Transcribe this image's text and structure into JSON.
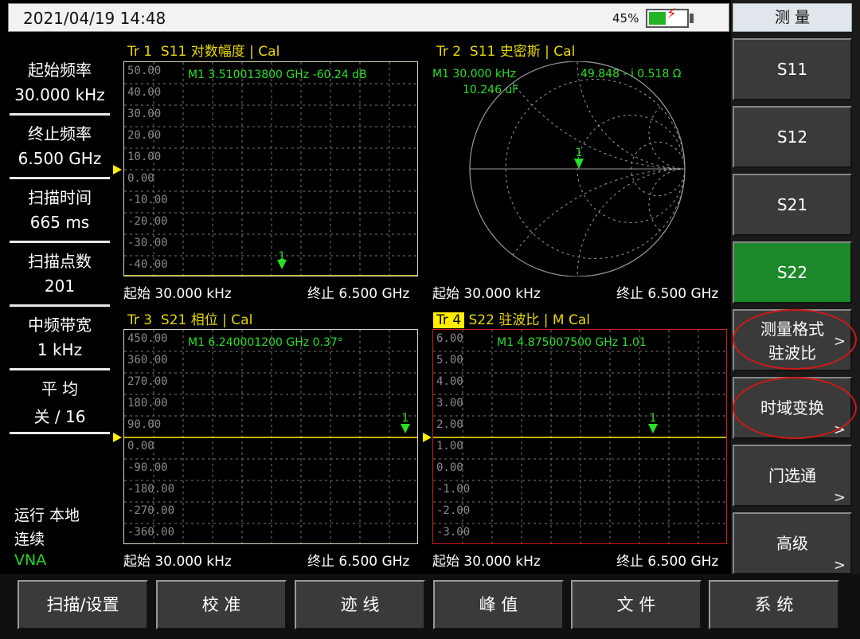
{
  "status": {
    "datetime": "2021/04/19 14:48",
    "battery_percent_label": "45%",
    "battery_level": 0.45
  },
  "left_params": [
    {
      "label": "起始频率",
      "value": "30.000 kHz"
    },
    {
      "label": "终止频率",
      "value": "6.500 GHz"
    },
    {
      "label": "扫描时间",
      "value": "665 ms"
    },
    {
      "label": "扫描点数",
      "value": "201"
    },
    {
      "label": "中频带宽",
      "value": "1 kHz"
    },
    {
      "label": "平 均",
      "value": "关 / 16"
    }
  ],
  "left_status": {
    "run": "运行 本地",
    "cont": "连续",
    "mode": "VNA"
  },
  "traces": {
    "tr1": {
      "id": "Tr 1",
      "title": "S11 对数幅度 | Cal",
      "marker_text": "M1   3.510013800 GHz   -60.24 dB",
      "marker_num": "1",
      "y_labels": [
        "50.00",
        "40.00",
        "30.00",
        "20.00",
        "10.00",
        "0.00",
        "-10.00",
        "-20.00",
        "-30.00",
        "-40.00"
      ],
      "start": "起始  30.000 kHz",
      "stop": "终止  6.500 GHz"
    },
    "tr2": {
      "id": "Tr 2",
      "title": "S11 史密斯 | Cal",
      "marker_line1": "M1   30.000 kHz",
      "marker_imp": "49.848  - i 0.518 Ω",
      "marker_line2": "10.246 uF",
      "marker_num": "1",
      "start": "起始  30.000 kHz",
      "stop": "终止  6.500 GHz"
    },
    "tr3": {
      "id": "Tr 3",
      "title": "S21 相位 | Cal",
      "marker_text": "M1   6.240001200 GHz   0.37°",
      "marker_num": "1",
      "y_labels": [
        "450.00",
        "360.00",
        "270.00",
        "180.00",
        "90.00",
        "0.00",
        "-90.00",
        "-180.00",
        "-270.00",
        "-360.00"
      ],
      "start": "起始  30.000 kHz",
      "stop": "终止  6.500 GHz"
    },
    "tr4": {
      "id": "Tr 4",
      "title": "S22 驻波比 | M Cal",
      "marker_text": "M1   4.875007500 GHz   1.01",
      "marker_num": "1",
      "y_labels": [
        "6.00",
        "5.00",
        "4.00",
        "3.00",
        "2.00",
        "1.00",
        "0.00",
        "-1.00",
        "-2.00",
        "-3.00"
      ],
      "start": "起始  30.000 kHz",
      "stop": "终止  6.500 GHz"
    }
  },
  "softkeys": {
    "header": "测 量",
    "items": [
      {
        "main": "S11",
        "sub": "",
        "arrow": ""
      },
      {
        "main": "S12",
        "sub": "",
        "arrow": ""
      },
      {
        "main": "S21",
        "sub": "",
        "arrow": ""
      },
      {
        "main": "S22",
        "sub": "",
        "arrow": ""
      },
      {
        "main": "测量格式",
        "sub": "驻波比",
        "arrow": ">"
      },
      {
        "main": "时域变换",
        "sub": "",
        "arrow": ">"
      },
      {
        "main": "门选通",
        "sub": "",
        "arrow": ">"
      },
      {
        "main": "高级",
        "sub": "",
        "arrow": ">"
      }
    ]
  },
  "bottom_menu": [
    "扫描/设置",
    "校 准",
    "迹 线",
    "峰 值",
    "文 件",
    "系 统"
  ],
  "colors": {
    "trace": "#ffee00",
    "marker": "#27e027",
    "active_key": "#1c8a2a",
    "highlight": "#d01818"
  }
}
